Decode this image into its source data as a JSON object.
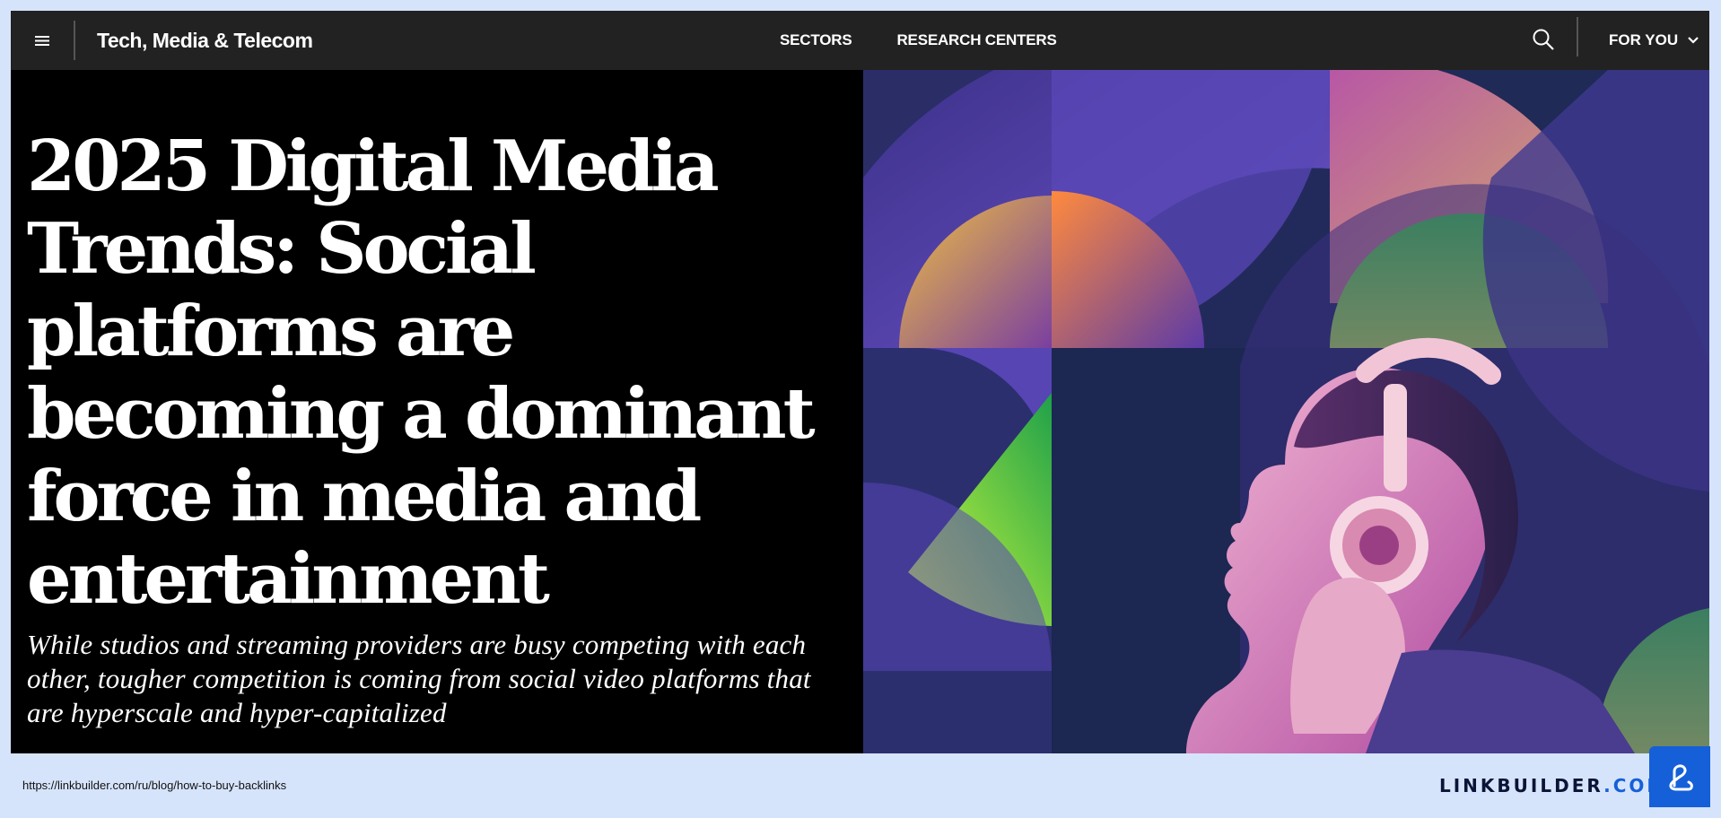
{
  "topbar": {
    "menu_icon": "hamburger-menu-icon",
    "site_title": "Tech, Media & Telecom",
    "nav": [
      "SECTORS",
      "RESEARCH CENTERS"
    ],
    "search_icon": "search-icon",
    "for_you_label": "FOR YOU",
    "for_you_icon": "chevron-down-icon"
  },
  "hero": {
    "title": "2025 Digital Media Trends: Social platforms are becoming a dominant force in media and entertainment",
    "subtitle": "While studios and streaming providers are busy competing with each other, tougher competition is coming from social video platforms that are hyperscale and hyper-capitalized"
  },
  "footer": {
    "url": "https://linkbuilder.com/ru/blog/how-to-buy-backlinks",
    "brand_name": "LINKBUILDER",
    "brand_dot": ".",
    "brand_tld": "COM",
    "brand_icon": "linkbuilder-logo-icon"
  },
  "colors": {
    "topbar": "#222222",
    "hero_bg": "#000000",
    "page_bg": "#d6e4fb",
    "brand_blue": "#1560d8"
  }
}
